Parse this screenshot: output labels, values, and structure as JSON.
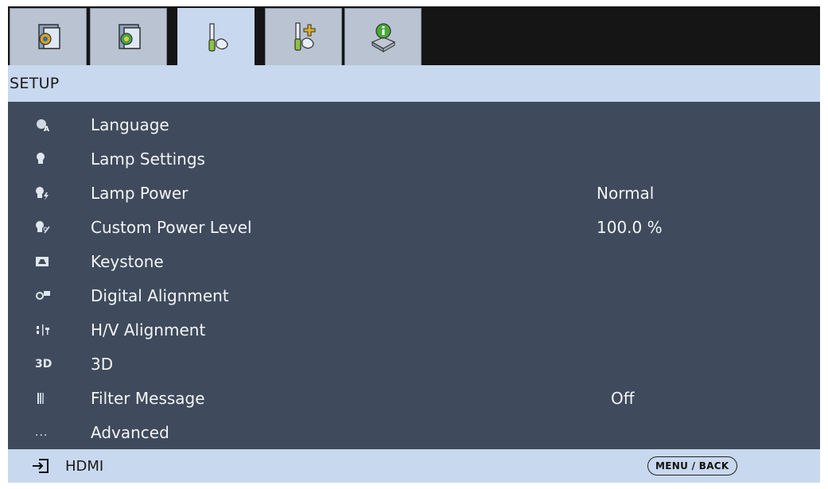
{
  "tabs": [
    {
      "icon": "image-settings-icon"
    },
    {
      "icon": "advanced-image-icon"
    },
    {
      "icon": "setup-tools-icon",
      "active": true
    },
    {
      "icon": "advanced-setup-icon"
    },
    {
      "icon": "information-icon"
    }
  ],
  "title": "SETUP",
  "menu": {
    "items": [
      {
        "icon": "language-icon",
        "label": "Language",
        "value": ""
      },
      {
        "icon": "lamp-settings-icon",
        "label": "Lamp Settings",
        "value": ""
      },
      {
        "icon": "lamp-power-icon",
        "label": "Lamp Power",
        "value": "Normal"
      },
      {
        "icon": "custom-power-level-icon",
        "label": "Custom Power Level",
        "value": "100.0 %"
      },
      {
        "icon": "keystone-icon",
        "label": "Keystone",
        "value": ""
      },
      {
        "icon": "digital-alignment-icon",
        "label": "Digital Alignment",
        "value": ""
      },
      {
        "icon": "hv-alignment-icon",
        "label": "H/V Alignment",
        "value": ""
      },
      {
        "icon": "3d-icon",
        "icon_text": "3D",
        "label": "3D",
        "value": ""
      },
      {
        "icon": "filter-message-icon",
        "label": "Filter Message",
        "value": "Off"
      },
      {
        "icon": "advanced-icon",
        "icon_text": "...",
        "label": "Advanced",
        "value": ""
      }
    ]
  },
  "status": {
    "source": "HDMI",
    "hint": "MENU / BACK"
  }
}
